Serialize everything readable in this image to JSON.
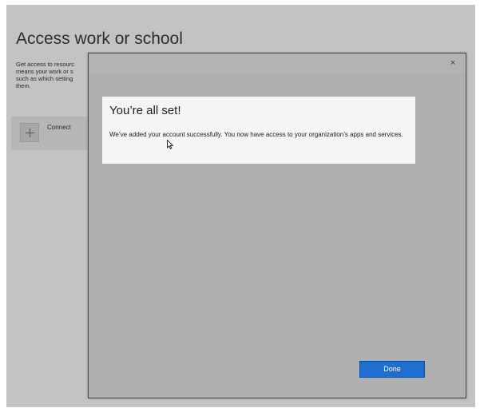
{
  "settings": {
    "title": "Access work or school",
    "description_lines": [
      "Get access to resourc",
      "means your work or s",
      "such as which setting",
      "them."
    ],
    "connect_label": "Connect",
    "connect_icon": "plus-icon"
  },
  "dialog": {
    "close_glyph": "×",
    "success_title": "You’re all set!",
    "success_message": "We’ve added your account successfully. You now have access to your organization’s apps and services.",
    "done_label": "Done",
    "done_color": "#1f6fd0"
  }
}
